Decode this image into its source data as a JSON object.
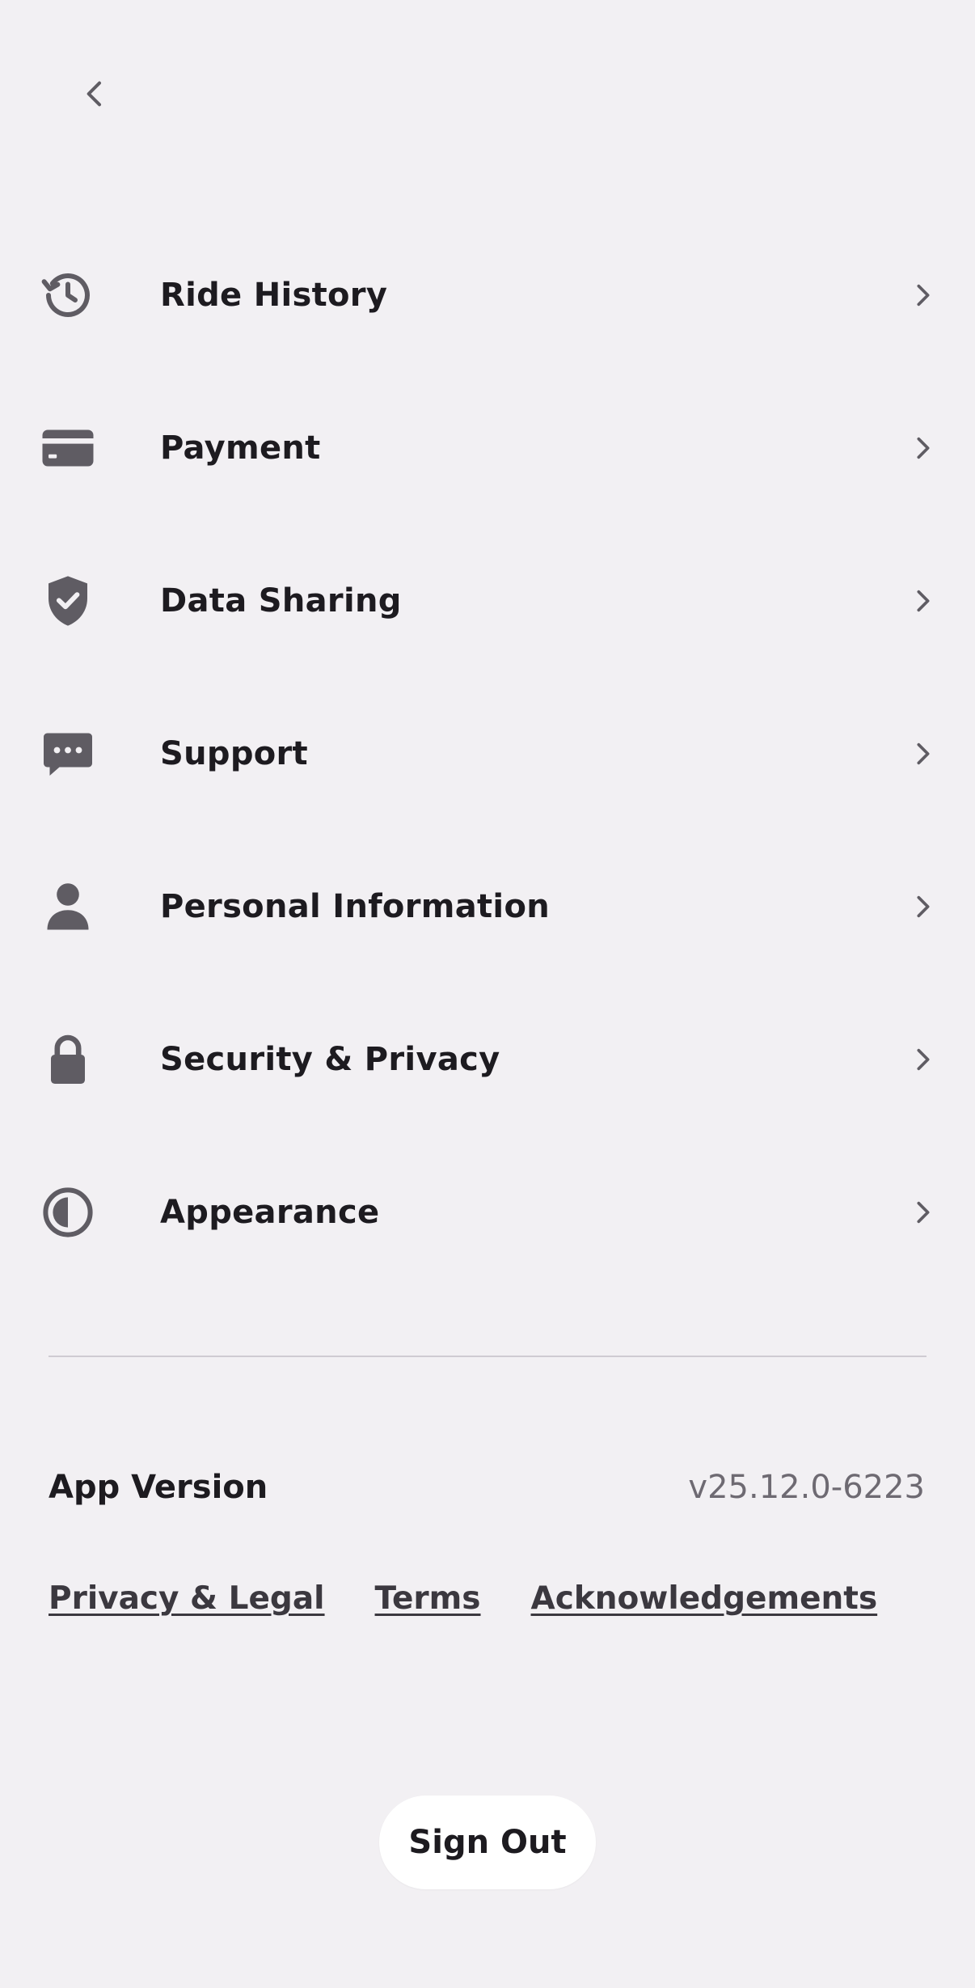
{
  "header": {
    "back_icon": "chevron-left-icon"
  },
  "menu": {
    "items": [
      {
        "label": "Ride History",
        "icon": "history-icon"
      },
      {
        "label": "Payment",
        "icon": "credit-card-icon"
      },
      {
        "label": "Data Sharing",
        "icon": "shield-check-icon"
      },
      {
        "label": "Support",
        "icon": "chat-bubble-icon"
      },
      {
        "label": "Personal Information",
        "icon": "person-icon"
      },
      {
        "label": "Security & Privacy",
        "icon": "lock-icon"
      },
      {
        "label": "Appearance",
        "icon": "contrast-icon"
      }
    ]
  },
  "app_version": {
    "label": "App Version",
    "value": "v25.12.0-6223"
  },
  "links": {
    "privacy_legal": "Privacy & Legal",
    "terms": "Terms",
    "acknowledgements": "Acknowledgements"
  },
  "sign_out": {
    "label": "Sign Out"
  },
  "colors": {
    "background": "#f2f0f3",
    "icon": "#5f5c63",
    "text": "#1d1b20",
    "secondary_text": "#6e6a72",
    "button_bg": "#ffffff"
  }
}
